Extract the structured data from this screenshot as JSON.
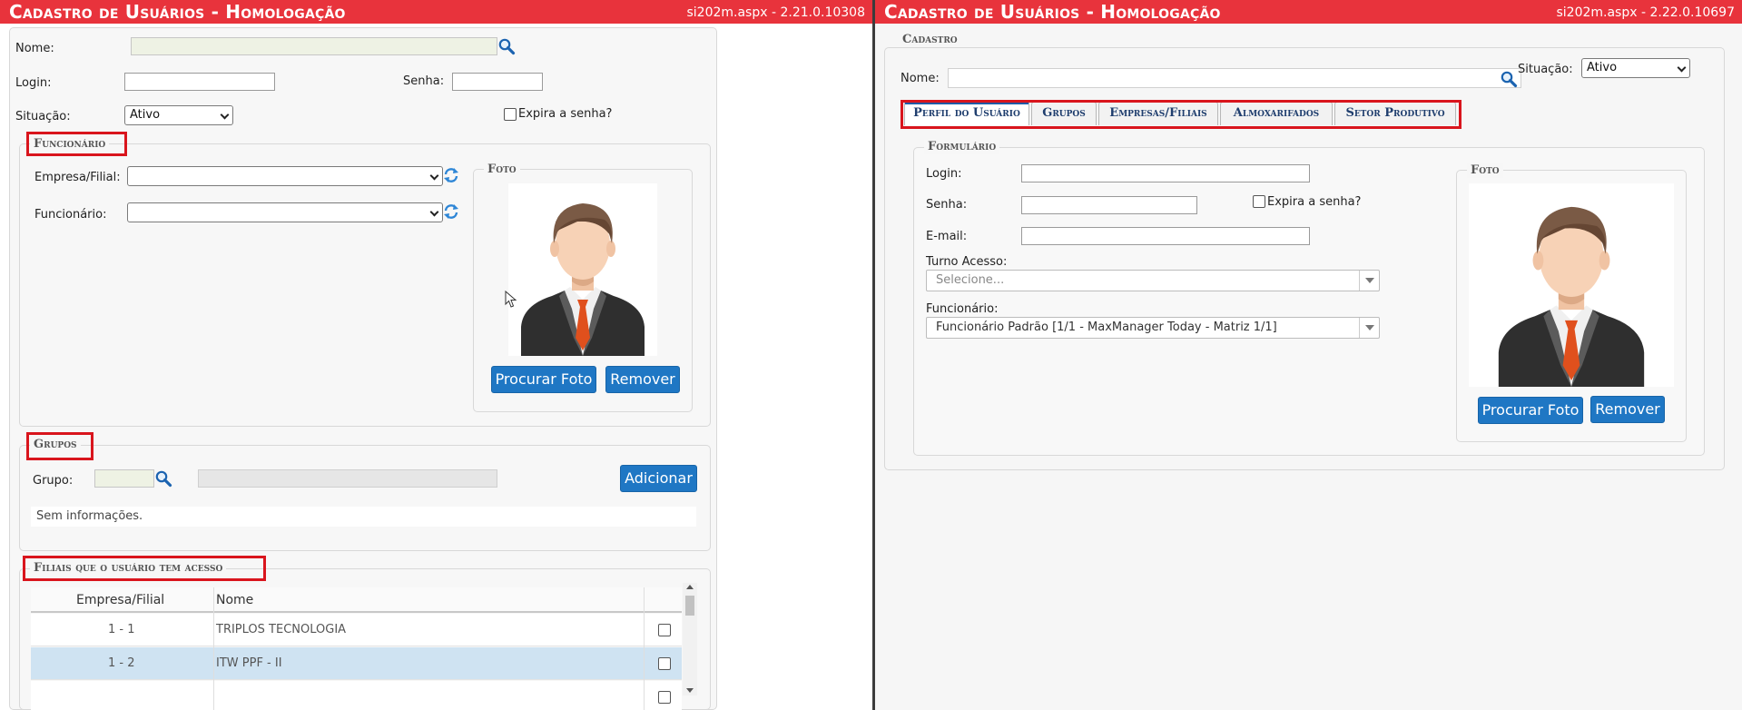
{
  "left": {
    "title": "Cadastro de Usuários  - Homologação",
    "version": "si202m.aspx - 2.21.0.10308",
    "nome_label": "Nome:",
    "login_label": "Login:",
    "senha_label": "Senha:",
    "situacao_label": "Situação:",
    "situacao_value": "Ativo",
    "expira_label": "Expira a senha?",
    "funcionario_section": {
      "legend": "Funcionário",
      "empresa_label": "Empresa/Filial:",
      "funcionario_label": "Funcionário:",
      "foto_legend": "Foto",
      "procurar_foto": "Procurar Foto",
      "remover": "Remover"
    },
    "grupos_section": {
      "legend": "Grupos",
      "grupo_label": "Grupo:",
      "adicionar": "Adicionar",
      "empty_text": "Sem informações."
    },
    "filiais_section": {
      "legend": "Filiais que o usuário tem acesso",
      "columns": [
        "Empresa/Filial",
        "Nome"
      ],
      "rows": [
        {
          "empresa": "1 - 1",
          "nome": "TRIPLOS TECNOLOGIA",
          "selected": false
        },
        {
          "empresa": "1 - 2",
          "nome": "ITW PPF - II",
          "selected": true
        }
      ]
    }
  },
  "right": {
    "title": "Cadastro de Usuários  - Homologação",
    "version": "si202m.aspx - 2.22.0.10697",
    "cadastro_legend": "Cadastro",
    "nome_label": "Nome:",
    "situacao_label": "Situação:",
    "situacao_value": "Ativo",
    "tabs": [
      {
        "label": "Perfil do Usuário",
        "active": true
      },
      {
        "label": "Grupos",
        "active": false
      },
      {
        "label": "Empresas/Filiais",
        "active": false
      },
      {
        "label": "Almoxarifados",
        "active": false
      },
      {
        "label": "Setor Produtivo",
        "active": false
      }
    ],
    "formulario": {
      "legend": "Formulário",
      "login_label": "Login:",
      "senha_label": "Senha:",
      "expira_label": "Expira a senha?",
      "email_label": "E-mail:",
      "turno_label": "Turno Acesso:",
      "turno_placeholder": "Selecione...",
      "funcionario_label": "Funcionário:",
      "funcionario_value": "Funcionário Padrão [1/1 - MaxManager Today - Matriz 1/1]"
    },
    "foto": {
      "legend": "Foto",
      "procurar_foto": "Procurar Foto",
      "remover": "Remover"
    }
  },
  "colors": {
    "titlebar": "#e8333c",
    "button": "#1f77c4",
    "highlight_box": "#d9151d",
    "selected_row": "#cfe3f2",
    "active_tab": "#1f5aa6"
  },
  "icons": [
    "search-icon",
    "refresh-icon",
    "avatar-icon",
    "checkbox-icon",
    "chevron-down-icon",
    "mouse-cursor-icon"
  ]
}
